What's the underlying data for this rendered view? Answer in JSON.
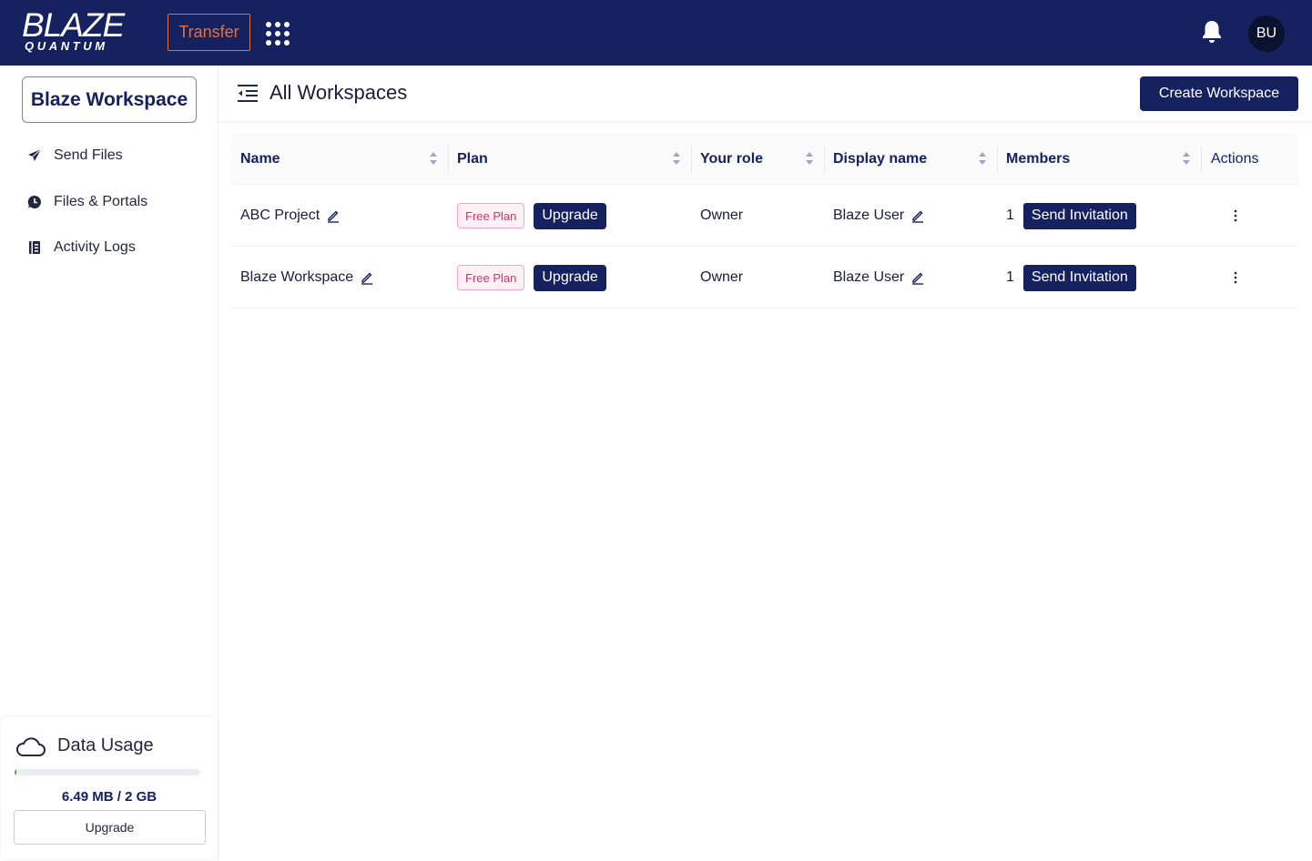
{
  "topbar": {
    "logo_main": "BLAZE",
    "logo_sub": "QUANTUM",
    "transfer_label": "Transfer",
    "apps_icon": "grid-apps-icon",
    "bell_icon": "bell-icon",
    "avatar_initials": "BU",
    "colors": {
      "background": "#162160",
      "transfer": "#e8703a"
    }
  },
  "sidebar": {
    "workspace_name": "Blaze Workspace",
    "items": [
      {
        "label": "Send Files",
        "icon": "paper-plane-icon"
      },
      {
        "label": "Files & Portals",
        "icon": "clock-chat-icon"
      },
      {
        "label": "Activity Logs",
        "icon": "log-book-icon"
      }
    ],
    "usage": {
      "title": "Data Usage",
      "text": "6.49 MB / 2 GB",
      "fraction": 0.0032,
      "upgrade_label": "Upgrade",
      "icon": "cloud-icon"
    }
  },
  "main": {
    "title": "All Workspaces",
    "create_label": "Create Workspace",
    "columns": [
      "Name",
      "Plan",
      "Your role",
      "Display name",
      "Members",
      "Actions"
    ],
    "rows": [
      {
        "name": "ABC Project",
        "plan": "Free Plan",
        "upgrade": "Upgrade",
        "role": "Owner",
        "display_name": "Blaze User",
        "members": "1",
        "invite": "Send Invitation"
      },
      {
        "name": "Blaze Workspace",
        "plan": "Free Plan",
        "upgrade": "Upgrade",
        "role": "Owner",
        "display_name": "Blaze User",
        "members": "1",
        "invite": "Send Invitation"
      }
    ]
  }
}
